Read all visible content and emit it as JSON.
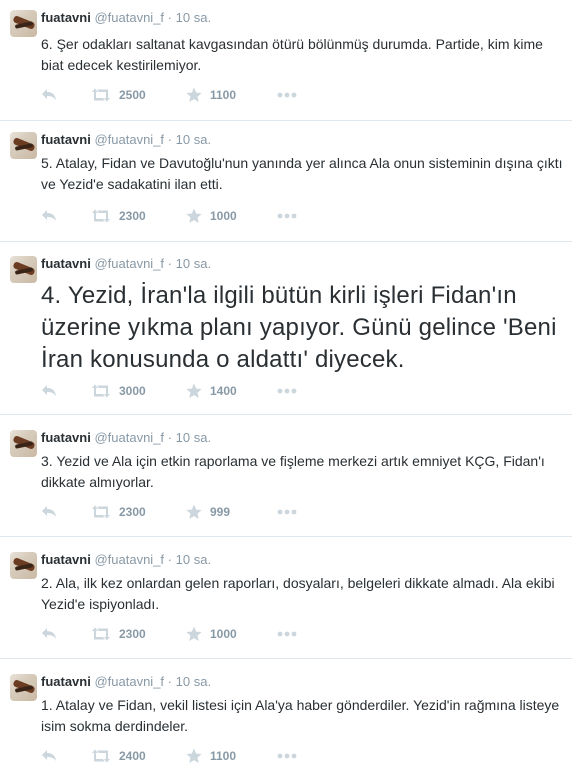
{
  "colors": {
    "text": "#292f33",
    "muted": "#8899a6",
    "icon": "#ccd6dd",
    "divider": "#e1e8ed"
  },
  "icons": {
    "reply": "reply-icon",
    "retweet": "retweet-icon",
    "favorite": "star-icon",
    "more": "more-icon"
  },
  "tweets": [
    {
      "name": "fuatavni",
      "handle": "@fuatavni_f",
      "separator": "·",
      "time": "10 sa.",
      "text": "6. Şer odakları saltanat kavgasından ötürü bölünmüş durumda. Partide, kim kime biat edecek kestirilemiyor.",
      "retweets": "2500",
      "favorites": "1100"
    },
    {
      "name": "fuatavni",
      "handle": "@fuatavni_f",
      "separator": "·",
      "time": "10 sa.",
      "text": "5. Atalay, Fidan ve Davutoğlu'nun yanında yer alınca Ala onun sisteminin dışına çıktı ve Yezid'e sadakatini ilan etti.",
      "retweets": "2300",
      "favorites": "1000"
    },
    {
      "name": "fuatavni",
      "handle": "@fuatavni_f",
      "separator": "·",
      "time": "10 sa.",
      "text": "4. Yezid, İran'la ilgili bütün kirli işleri Fidan'ın üzerine yıkma planı yapıyor. Günü gelince 'Beni İran konusunda o aldattı' diyecek.",
      "retweets": "3000",
      "favorites": "1400"
    },
    {
      "name": "fuatavni",
      "handle": "@fuatavni_f",
      "separator": "·",
      "time": "10 sa.",
      "text": "3. Yezid ve Ala için etkin raporlama ve fişleme merkezi artık emniyet KÇG, Fidan'ı dikkate almıyorlar.",
      "retweets": "2300",
      "favorites": "999"
    },
    {
      "name": "fuatavni",
      "handle": "@fuatavni_f",
      "separator": "·",
      "time": "10 sa.",
      "text": "2. Ala, ilk kez onlardan gelen raporları, dosyaları, belgeleri dikkate almadı. Ala ekibi Yezid'e ispiyonladı.",
      "retweets": "2300",
      "favorites": "1000"
    },
    {
      "name": "fuatavni",
      "handle": "@fuatavni_f",
      "separator": "·",
      "time": "10 sa.",
      "text": "1. Atalay ve Fidan, vekil listesi için Ala'ya haber gönderdiler. Yezid'in rağmına listeye isim sokma derdindeler.",
      "retweets": "2400",
      "favorites": "1100"
    }
  ]
}
